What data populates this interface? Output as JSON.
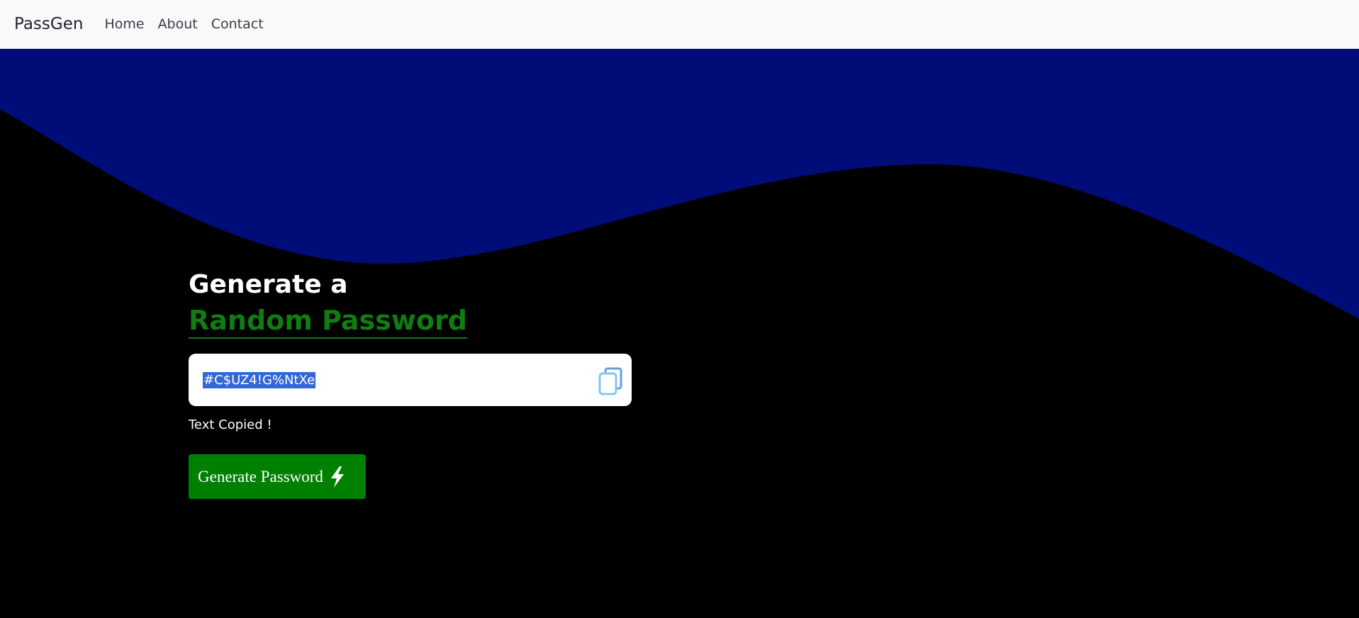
{
  "navbar": {
    "brand": "PassGen",
    "links": [
      "Home",
      "About",
      "Contact"
    ]
  },
  "hero": {
    "heading_line1": "Generate a",
    "heading_line2": "Random Password",
    "password_value": "#C$UZ4!G%NtXe",
    "status_text": "Text Copied !",
    "generate_label": "Generate Password"
  },
  "colors": {
    "wave": "#000c78",
    "accent_green": "#008000",
    "heading_green": "#0f7d0f",
    "selection": "#3367d6"
  },
  "icons": {
    "copy": "copy-icon",
    "generate": "lightning-bolt-icon"
  }
}
